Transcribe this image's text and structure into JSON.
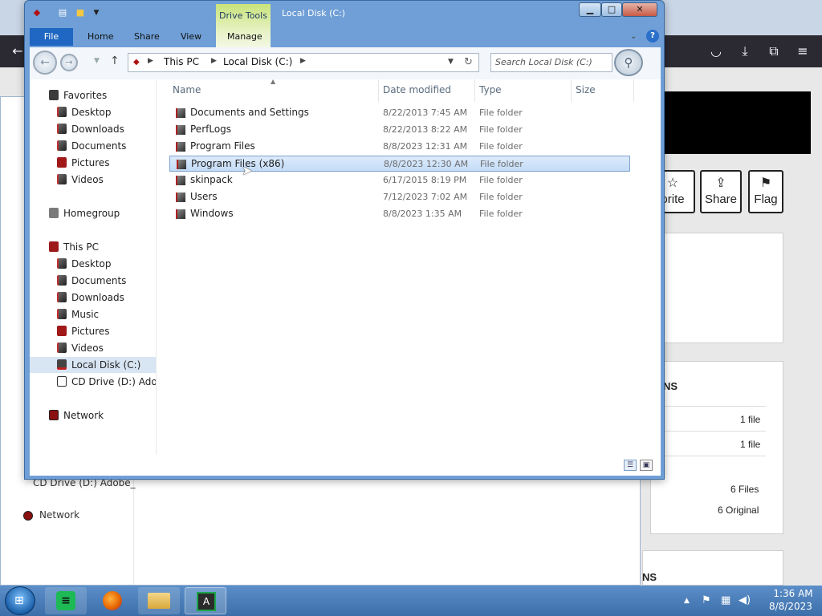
{
  "window": {
    "title": "Local Disk (C:)",
    "contextual_tab_group": "Drive Tools",
    "minimize": "▁",
    "maximize": "□",
    "close": "✕"
  },
  "ribbon": {
    "tabs": [
      {
        "label": "File"
      },
      {
        "label": "Home"
      },
      {
        "label": "Share"
      },
      {
        "label": "View"
      },
      {
        "label": "Manage"
      }
    ]
  },
  "address": {
    "crumbs": [
      "This PC",
      "Local Disk (C:)"
    ],
    "search_placeholder": "Search Local Disk (C:)"
  },
  "nav_pane": {
    "favorites_label": "Favorites",
    "favorites": [
      {
        "label": "Desktop"
      },
      {
        "label": "Downloads"
      },
      {
        "label": "Documents"
      },
      {
        "label": "Pictures"
      },
      {
        "label": "Videos"
      }
    ],
    "homegroup_label": "Homegroup",
    "this_pc_label": "This PC",
    "this_pc": [
      {
        "label": "Desktop"
      },
      {
        "label": "Documents"
      },
      {
        "label": "Downloads"
      },
      {
        "label": "Music"
      },
      {
        "label": "Pictures"
      },
      {
        "label": "Videos"
      },
      {
        "label": "Local Disk (C:)"
      },
      {
        "label": "CD Drive (D:) Adobe_"
      }
    ],
    "network_label": "Network",
    "selected": "Local Disk (C:)"
  },
  "file_list": {
    "columns": [
      "Name",
      "Date modified",
      "Type",
      "Size"
    ],
    "rows": [
      {
        "name": "Documents and Settings",
        "date": "8/22/2013 7:45 AM",
        "type": "File folder",
        "size": ""
      },
      {
        "name": "PerfLogs",
        "date": "8/22/2013 8:22 AM",
        "type": "File folder",
        "size": ""
      },
      {
        "name": "Program Files",
        "date": "8/8/2023 12:31 AM",
        "type": "File folder",
        "size": ""
      },
      {
        "name": "Program Files (x86)",
        "date": "8/8/2023 12:30 AM",
        "type": "File folder",
        "size": ""
      },
      {
        "name": "skinpack",
        "date": "6/17/2015 8:19 PM",
        "type": "File folder",
        "size": ""
      },
      {
        "name": "Users",
        "date": "7/12/2023 7:02 AM",
        "type": "File folder",
        "size": ""
      },
      {
        "name": "Windows",
        "date": "8/8/2023 1:35 AM",
        "type": "File folder",
        "size": ""
      }
    ],
    "selected_row": "Program Files (x86)"
  },
  "background_browser": {
    "buttons": [
      {
        "label": "orite",
        "glyph": "☆"
      },
      {
        "label": "Share",
        "glyph": "⇪"
      },
      {
        "label": "Flag",
        "glyph": "⚑"
      }
    ],
    "section_title": "NS",
    "section_title_2": "NS",
    "counts": [
      "1 file",
      "1 file",
      "6 Files",
      "6 Original"
    ]
  },
  "background_explorer": {
    "cd_drive_label": "CD Drive (D:) Adobe_",
    "network_label": "Network"
  },
  "taskbar": {
    "apps": [
      "Spotify",
      "Firefox",
      "File Explorer",
      "Adobe Acrobat"
    ],
    "clock_time": "1:36 AM",
    "clock_date": "8/8/2023"
  }
}
